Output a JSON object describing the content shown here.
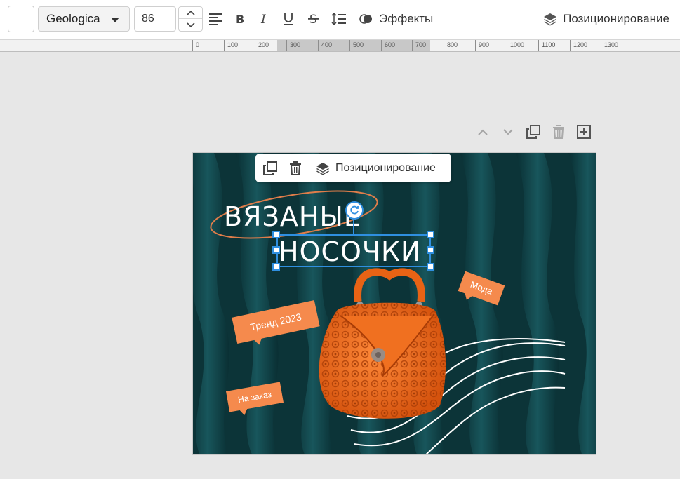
{
  "toolbar": {
    "font_name": "Geologica",
    "font_size": "86",
    "effects_label": "Эффекты",
    "positioning_label": "Позиционирование",
    "icons": [
      "color-swatch",
      "align-left-icon",
      "bold-icon",
      "italic-icon",
      "underline-icon",
      "strikethrough-icon",
      "line-height-icon",
      "effects-icon",
      "layers-icon"
    ]
  },
  "ruler": {
    "marks": [
      "0",
      "100",
      "200",
      "300",
      "400",
      "500",
      "600",
      "700",
      "800",
      "900",
      "1000",
      "1100",
      "1200",
      "1300"
    ]
  },
  "slide_controls": {
    "icons": [
      "chevron-up-icon",
      "chevron-down-icon",
      "duplicate-icon",
      "trash-icon",
      "add-slide-icon"
    ]
  },
  "floating_bar": {
    "positioning_label": "Позиционирование",
    "icons": [
      "duplicate-icon",
      "trash-icon",
      "layers-icon"
    ]
  },
  "slide": {
    "title_line1": "ВЯЗАНЫЕ",
    "title_line2": "НОСОЧКИ",
    "tag_trend": "Тренд 2023",
    "tag_fashion": "Мода",
    "tag_order": "На заказ"
  },
  "colors": {
    "selection": "#2f8fe0",
    "tag_orange": "#f58a4d",
    "background_teal": "#0d3a3e",
    "bag_orange": "#f06a1a"
  }
}
